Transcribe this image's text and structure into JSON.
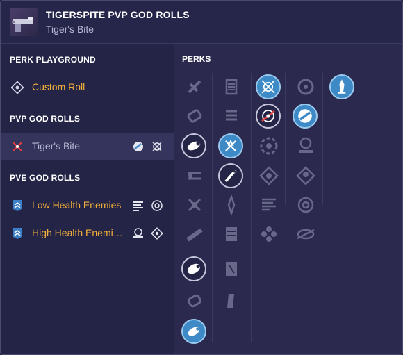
{
  "header": {
    "title": "TIGERSPITE PVP GOD ROLLS",
    "subtitle": "Tiger's Bite"
  },
  "sidebar": {
    "perk_playground": {
      "heading": "PERK PLAYGROUND",
      "items": [
        {
          "label": "Custom Roll",
          "icon": "crosshair-diamond-icon"
        }
      ]
    },
    "pvp": {
      "heading": "PVP GOD ROLLS",
      "items": [
        {
          "label": "Tiger's Bite",
          "icon": "crossed-out-icon"
        }
      ]
    },
    "pve": {
      "heading": "PVE GOD ROLLS",
      "items": [
        {
          "label": "Low Health Enemies",
          "icon": "chevron-rank-icon"
        },
        {
          "label": "High Health Enemi…",
          "icon": "chevron-rank-icon"
        }
      ]
    }
  },
  "perks": {
    "heading": "PERKS",
    "colors": {
      "selected": "#3d8ac7",
      "gold": "#f4b13a",
      "muted": "#b7b6d3"
    }
  }
}
